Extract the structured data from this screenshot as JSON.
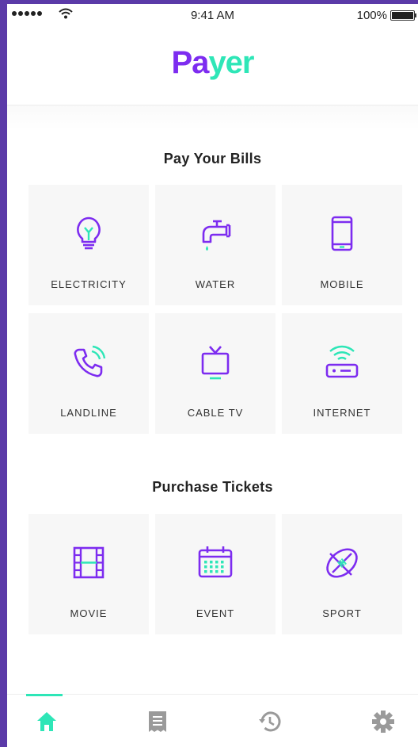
{
  "status_bar": {
    "time": "9:41 AM",
    "battery": "100%"
  },
  "app": {
    "logo_part1": "Pa",
    "logo_part2": "yer"
  },
  "bills": {
    "title": "Pay Your Bills",
    "items": [
      {
        "label": "ELECTRICITY",
        "icon": "lightbulb-icon"
      },
      {
        "label": "WATER",
        "icon": "water-tap-icon"
      },
      {
        "label": "MOBILE",
        "icon": "mobile-phone-icon"
      },
      {
        "label": "LANDLINE",
        "icon": "landline-phone-icon"
      },
      {
        "label": "CABLE TV",
        "icon": "tv-icon"
      },
      {
        "label": "INTERNET",
        "icon": "router-icon"
      }
    ]
  },
  "tickets": {
    "title": "Purchase Tickets",
    "items": [
      {
        "label": "MOVIE",
        "icon": "film-icon"
      },
      {
        "label": "EVENT",
        "icon": "calendar-icon"
      },
      {
        "label": "SPORT",
        "icon": "football-icon"
      }
    ]
  },
  "tab_bar": {
    "items": [
      {
        "icon": "home-icon",
        "active": true
      },
      {
        "icon": "receipt-icon",
        "active": false
      },
      {
        "icon": "history-icon",
        "active": false
      },
      {
        "icon": "settings-icon",
        "active": false
      }
    ]
  },
  "colors": {
    "purple": "#7d2cf0",
    "teal": "#2ee6b7",
    "frame": "#5b3aa8",
    "tab_inactive": "#9a9a9a"
  }
}
